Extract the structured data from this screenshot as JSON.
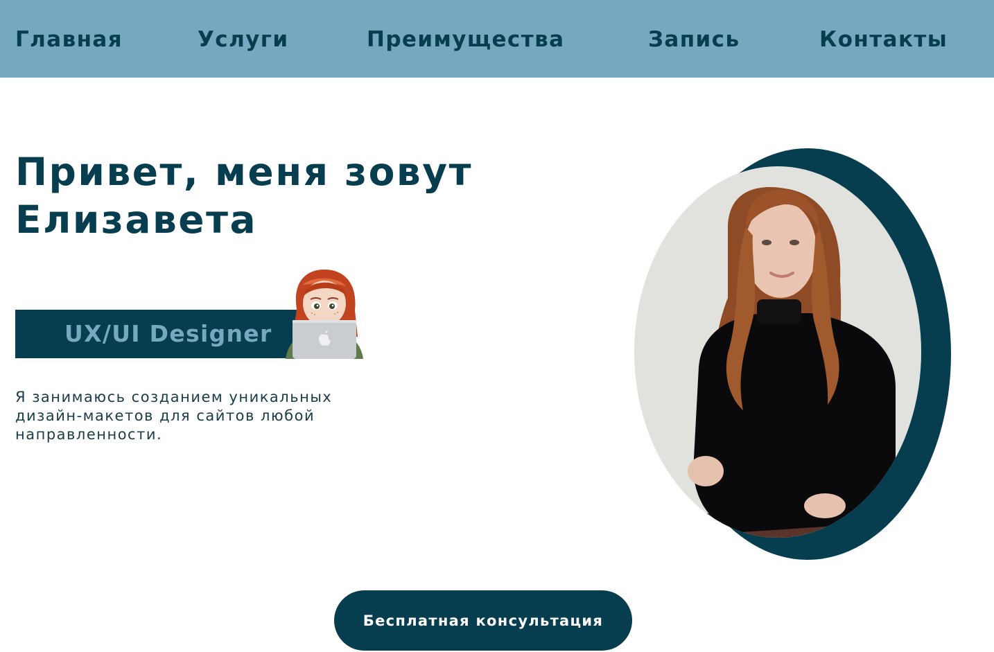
{
  "nav": {
    "items": [
      {
        "label": "Главная"
      },
      {
        "label": "Услуги"
      },
      {
        "label": "Преимущества"
      },
      {
        "label": "Запись"
      },
      {
        "label": "Контакты"
      }
    ]
  },
  "hero": {
    "title_line1": "Привет, меня зовут",
    "title_line2": "Елизавета",
    "role": "UX/UI Designer",
    "description": "Я занимаюсь созданием уникальных дизайн-макетов для сайтов любой направленности."
  },
  "cta": {
    "label": "Бесплатная консультация"
  },
  "colors": {
    "nav_background": "#76a9bf",
    "brand_dark": "#063e4f",
    "background": "#ffffff"
  },
  "icons": {
    "avatar": "memoji-avatar-with-laptop-icon",
    "laptop_logo": "apple-logo-icon",
    "portrait": "portrait-photo"
  }
}
